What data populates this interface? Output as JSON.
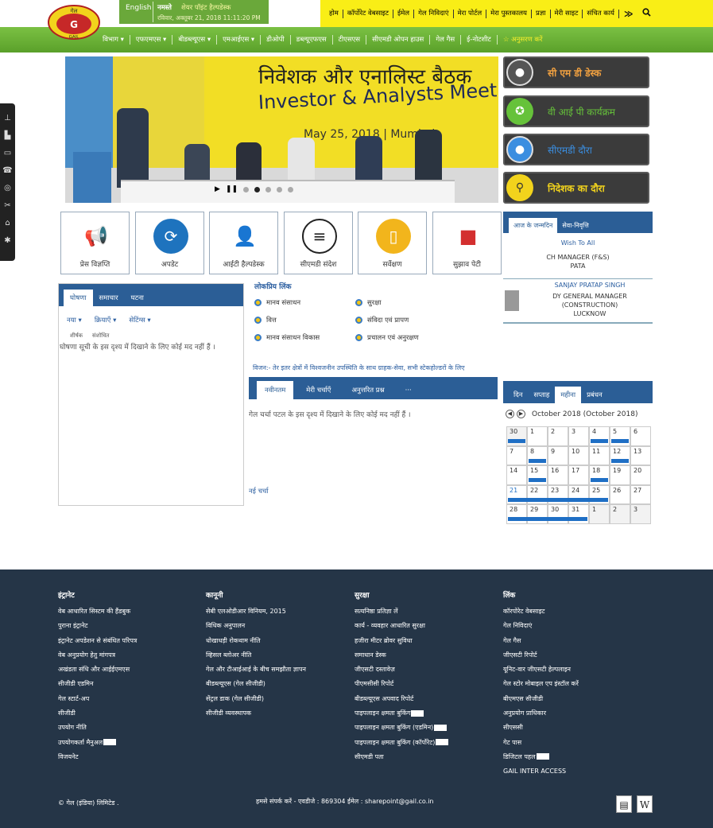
{
  "top": {
    "lang": "English",
    "greeting": "नमस्ते",
    "site_name": "शेयर पॉइंट हैल्पडेस्क",
    "datetime": "रविवार, अक्तूबर 21, 2018 11:11:20 PM",
    "links": [
      "होम",
      "कॉर्पोरेट वेबसाइट",
      "ईमेल",
      "गेल निविदाएं",
      "मेरा पोर्टल",
      "मेरा पुस्तकालय",
      "प्रज्ञा",
      "मेरी साइट",
      "संचित कार्य"
    ],
    "more_icon": "double-chevron-icon",
    "search_icon": "search-icon"
  },
  "logo": {
    "text_top": "गेल",
    "text_bottom": "GAIL"
  },
  "nav": [
    "विभाग ▾",
    "एफएमएस ▾",
    "बीडब्ल्यूएस ▾",
    "एमआईएस ▾",
    "डीओपी",
    "डब्ल्यूएफएस",
    "टीएसएस",
    "सीएमडी ओपन हाउस",
    "गेल गैस",
    "ई-नोटशीट",
    "☆ अनुसरण करें"
  ],
  "slider": {
    "heading_hi": "निवेशक और एनालिस्ट बैठक",
    "heading_en": "Investor & Analysts Meet",
    "date": "May 25, 2018 | Mumbai",
    "controls": {
      "play": "▶",
      "pause": "❚❚"
    },
    "active_dot": 1
  },
  "side_buttons": [
    {
      "label": "सी एम डी डेस्क",
      "color": "#f0a040",
      "icon": "cmd-avatar-icon"
    },
    {
      "label": "वी आई पी  कार्यक्रम",
      "color": "#66c23a",
      "icon": "award-badge-icon"
    },
    {
      "label": "सीएमडी दौरा",
      "color": "#3b8ee0",
      "icon": "visit-avatar-icon"
    },
    {
      "label": "निदेशक का दौरा",
      "color": "#f2d31c",
      "icon": "map-pin-icon"
    }
  ],
  "tiles": [
    {
      "label": "प्रेस विज्ञप्ति",
      "icon": "megaphone-icon",
      "color": "#ffffff"
    },
    {
      "label": "अपडेट",
      "icon": "refresh-icon",
      "color": "#1e73be"
    },
    {
      "label": "आईटी हैल्पडेस्क",
      "icon": "helpdesk-icon",
      "color": "#ffffff"
    },
    {
      "label": "सीएमडी संदेश",
      "icon": "chat-bubble-icon",
      "color": "#ffffff"
    },
    {
      "label": "सर्वेक्षण",
      "icon": "clipboard-icon",
      "color": "#f2b51c"
    },
    {
      "label": "सुझाव पेटी",
      "icon": "suggestion-box-icon",
      "color": "#ffffff"
    }
  ],
  "birthday": {
    "tabs": [
      "आज के जन्मदिन",
      "सेवा-निवृत्ति"
    ],
    "wish_all": "Wish To All",
    "entry1": {
      "line1": "CH MANAGER (F&S)",
      "line2": "PATA"
    },
    "entry2": {
      "name": "SANJAY PRATAP SINGH",
      "line1": "DY GENERAL MANAGER",
      "line2": "(CONSTRUCTION)",
      "line3": "LUCKNOW"
    }
  },
  "announcements": {
    "tabs": [
      "घोषणा",
      "समाचार",
      "घटना"
    ],
    "tools": [
      "नया ▾",
      "क्रियाएँ ▾",
      "सेटिंग्स ▾"
    ],
    "columns": [
      "शीर्षक",
      "संशोधित"
    ],
    "empty": "घोषणा सूची के इस दृश्य में दिखाने के लिए कोई मद नहीं हैं ।"
  },
  "popular": {
    "title": "लोकप्रिय लिंक",
    "links": [
      "मानव संसाधन",
      "सुरक्षा",
      "वित्त",
      "संविदा एवं प्रापण",
      "मानव संसाधन विकास",
      "प्रचालन एवं अनुरक्षण"
    ]
  },
  "vision": "विजन:- तेर इतर क्षेत्रों में विश्वजनीन उपस्थिति के साथ ग्राहक-सेवा, सभी स्टेकहोल्डरों के लिए",
  "discussion": {
    "tabs": [
      "नवीनतम",
      "मेरी चर्चाएँ",
      "अनुत्तरित प्रश्न",
      "···"
    ],
    "empty": "गेल चर्चा पटल के इस दृश्य में दिखाने के लिए कोई मद नहीं हैं ।",
    "new_link": "नई चर्चा"
  },
  "calendar": {
    "tabs": [
      "दिन",
      "सप्ताह",
      "महीना",
      "प्रबंधन"
    ],
    "active_tab": 2,
    "month": "October 2018 (October 2018)",
    "days": [
      "30",
      "1",
      "2",
      "3",
      "4",
      "5",
      "6",
      "7",
      "8",
      "9",
      "10",
      "11",
      "12",
      "13",
      "14",
      "15",
      "16",
      "17",
      "18",
      "19",
      "20",
      "21",
      "22",
      "23",
      "24",
      "25",
      "26",
      "27",
      "28",
      "29",
      "30",
      "31",
      "1",
      "2",
      "3"
    ],
    "today": "21",
    "event_color": "#1f6fc5"
  },
  "footer": {
    "columns": [
      {
        "title": "इंट्रानेट",
        "links": [
          "वेब आधारित सिस्टम की हैंडबुक",
          "पुराना इंट्रानेट",
          "इंट्रानेट अपडेशन से संबंधित परिपत्र",
          "वेब अनुप्रयोग हेतु मांगपत्र",
          "अखंडता संधि और आईईएमएस",
          "सीजीडी एडमिन",
          "गेल स्टार्ट-अप",
          "सीजीडी",
          "उपयोग नीति",
          "उपयोगकर्ता मैनुअल",
          "विजयनेट"
        ]
      },
      {
        "title": "कानूनी",
        "links": [
          "सेबी एलओडीआर विनियम, 2015",
          "विधिक अनुपालन",
          "धोखाधड़ी रोकथाम नीति",
          "व्हिसल ब्लोअर नीति",
          "गेल और टीआईआई के बीच समझौता ज्ञापन",
          "बीडब्ल्यूएस (गेल सीजीडी)",
          "सेंट्रल डाक (गेल सीजीडी)",
          "सीजीडी व्यवस्थापक"
        ]
      },
      {
        "title": "सुरक्षा",
        "links": [
          "सत्यनिष्ठा प्रतिज्ञा लें",
          "कार्य - व्यवहार आधारित सुरक्षा",
          "हजीरा मीटर ब्रोवर सुविधा",
          "समाधान डेस्क",
          "जीएसटी दस्तावेज़",
          "पीएमसीसी रिपोर्ट",
          "बीडब्ल्यूएस अपवाद रिपोर्ट",
          "पाइपलाइन क्षमता बुकिंग",
          "पाइपलाइन क्षमता बुकिंग (एडमिन)",
          "पाइपलाइन क्षमता बुकिंग (कॉर्पोरेट)",
          "सीएमडी पता"
        ]
      },
      {
        "title": "लिंक",
        "links": [
          "कॉरपोरेट वेबसाइट",
          "गेल निविदाएं",
          "गेल गैस",
          "जीएसटी रिपोर्ट",
          "यूनिट-वार जीएसटी हेल्पलाइन",
          "गेल स्टोर मोबाइल एप इंस्टॉल करें",
          "बीएमएस सीजीडी",
          "अनुप्रयोग प्राधिकार",
          "सीएससी",
          "गेट पास",
          "डिजिटल पहल",
          "GAIL INTER ACCESS"
        ]
      }
    ],
    "copyright": "© गेल (इंडिया) लिमिटेड .",
    "contact": "हमसे संपर्क करें - एवडीजे : 869304  ईमेल : sharepoint@gail.co.in",
    "icons": [
      "clipboard-icon",
      "wikipedia-icon"
    ]
  },
  "colors": {
    "brand_green": "#6aa83a",
    "top_yellow": "#f9ee16",
    "panel_blue": "#2b5e96",
    "footer_bg": "#253547"
  }
}
